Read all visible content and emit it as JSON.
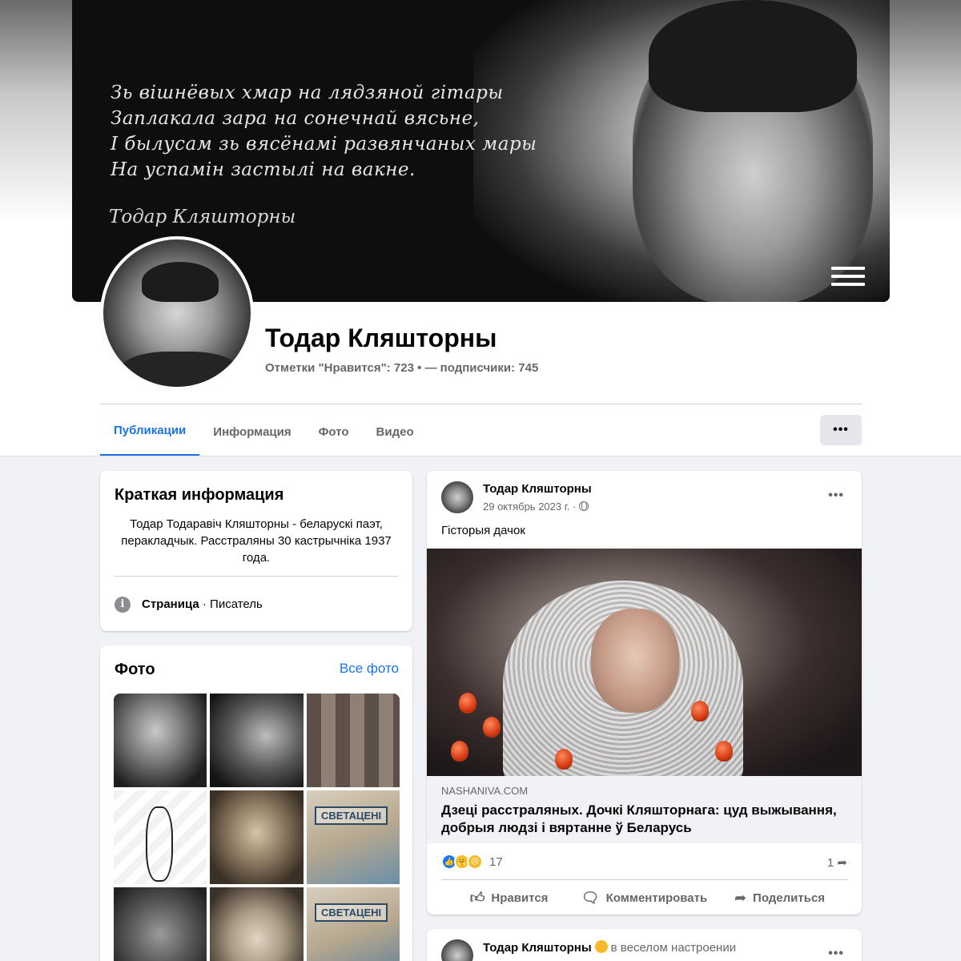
{
  "cover": {
    "poem_lines": [
      "Зь вішнёвых хмар на лядзяной гітары",
      "Заплакала зара на сонечнай вясьне,",
      "І былусам зь вясёнамі развянчаных мары",
      "На успамін застылі на вакне."
    ],
    "signature": "Тодар Кляшторны",
    "menu_icon": "hamburger-menu-icon"
  },
  "page": {
    "name": "Тодар Кляшторны",
    "stats": "Отметки \"Нравится\": 723 • — подписчики: 745"
  },
  "tabs": [
    "Публикации",
    "Информация",
    "Фото",
    "Видео"
  ],
  "more_label": "•••",
  "intro": {
    "title": "Краткая информация",
    "text": "Тодар Тодаравіч Кляшторны - беларускі паэт, перакладчык. Расстраляны 30 кастрычніка 1937 года.",
    "category_label": "Страница",
    "category_value": " · Писатель"
  },
  "photos": {
    "title": "Фото",
    "all_link": "Все фото",
    "thumb_labels": [
      "СВЕТАЦЕНІ",
      "СВЕТАЦЕНІ"
    ]
  },
  "post": {
    "author": "Тодар Кляшторны",
    "date": "29 октябрь 2023 г. ·",
    "text": "Гісторыя дачок",
    "link_domain": "NASHANIVA.COM",
    "link_title": "Дзеці расстраляных. Дочкі Кляшторнага: цуд выжывання, добрыя людзі і вяртанне ў Беларусь",
    "reaction_count": "17",
    "share_count": "1",
    "actions": {
      "like": "Нравится",
      "comment": "Комментировать",
      "share": "Поделиться"
    },
    "menu": "•••"
  },
  "post2": {
    "author": "Тодар Кляшторны",
    "mood": "в веселом настроении"
  },
  "colors": {
    "accent": "#1b74e4",
    "background": "#f0f2f5",
    "secondary_text": "#65676b"
  }
}
